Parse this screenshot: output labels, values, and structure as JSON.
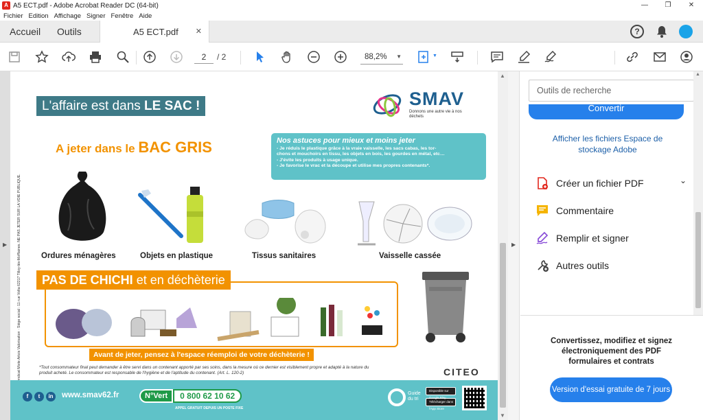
{
  "window": {
    "title": "A5 ECT.pdf - Adobe Acrobat Reader DC (64-bit)",
    "minimize": "—",
    "restore": "❐",
    "close": "✕"
  },
  "menu": [
    "Fichier",
    "Edition",
    "Affichage",
    "Signer",
    "Fenêtre",
    "Aide"
  ],
  "tabs": {
    "home": "Accueil",
    "tools": "Outils",
    "doc": "A5 ECT.pdf",
    "close": "✕"
  },
  "toolbar": {
    "page_current": "2",
    "page_total": "/ 2",
    "zoom": "88,2%"
  },
  "page": {
    "sidetext": "SMAV – Syndicat Mixte Artois Valorisation · Siège social : 11 rue Volta 62217 Tilloy-lès-Mofflaines. NE PAS JETER SUR LA VOIE PUBLIQUE.",
    "banner_thin": "L'affaire est dans ",
    "banner_bold": "LE SAC !",
    "logo_word": "SMAV",
    "logo_tag": "Donnons une autre vie à nos déchets",
    "bac_prefix": "A jeter dans le ",
    "bac_bold": "BAC GRIS",
    "astuces_title": "Nos astuces pour mieux et moins jeter",
    "astuces_lines": [
      "- Je réduis le plastique grâce à la vraie vaisselle, les sacs cabas, les tor-",
      "chons et mouchoirs en tissu, les objets en bois, les gourdes en métal, etc…",
      "- J'évite les produits à usage unique.",
      "- Je favorise le vrac et la découpe et utilise mes propres contenants*."
    ],
    "items": [
      "Ordures ménagères",
      "Objets en plastique",
      "Tissus sanitaires",
      "Vaisselle cassée"
    ],
    "chichi_bold": "PAS DE CHICHI",
    "chichi_thin": " et en déchèterie",
    "reemploi": "Avant de jeter, pensez à l'espace réemploi de votre déchèterie !",
    "footnote": "*Tout consommateur final peut demander à être servi dans un contenant apporté par ses soins, dans la mesure où ce dernier est visiblement propre et adapté à la nature du produit acheté. Le consommateur est responsable de l'hygiène et de l'aptitude du contenant. (Art. L. 120-2)",
    "citeo": "CITEO",
    "site": "www.smav62.fr",
    "vert_badge": "N°Vert",
    "vert_num": "0 800 62 10 62",
    "appel": "APPEL GRATUIT DEPUIS UN POSTE FIXE",
    "guide": "Guide du tri",
    "store_google": "Disponible sur Google Play",
    "store_apple": "Télécharger dans l'App Store"
  },
  "panel": {
    "search_placeholder": "Outils de recherche",
    "convertir": "Convertir",
    "storage_link": "Afficher les fichiers Espace de stockage Adobe",
    "tools": [
      "Créer un fichier PDF",
      "Commentaire",
      "Remplir et signer",
      "Autres outils"
    ],
    "promo": "Convertissez, modifiez et signez électroniquement des PDF formulaires et contrats",
    "trial": "Version d'essai gratuite de 7 jours"
  },
  "colors": {
    "accent": "#2680eb",
    "orange": "#f29200",
    "teal": "#5fc2c8",
    "banner": "#3e7a87"
  }
}
